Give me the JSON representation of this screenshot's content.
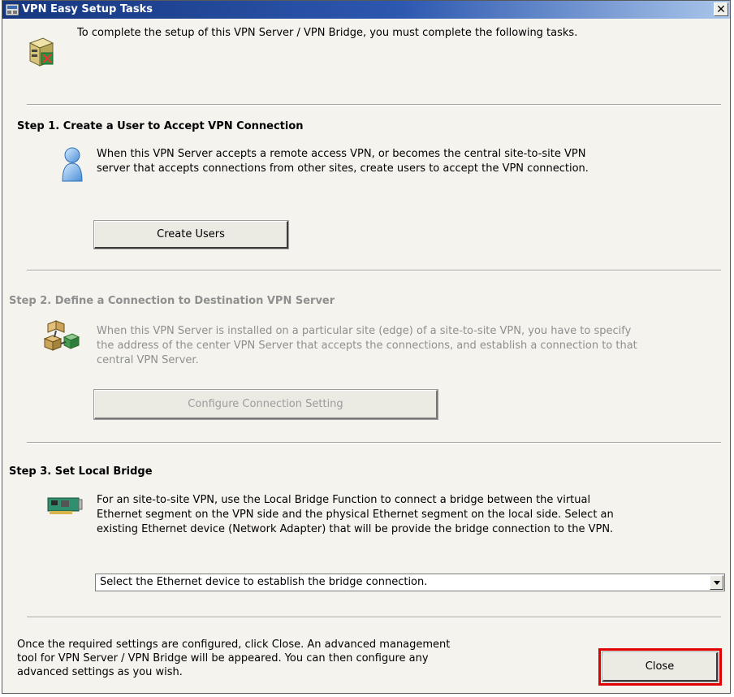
{
  "window": {
    "title": "VPN Easy Setup Tasks",
    "close_glyph": "✕"
  },
  "intro": "To complete the setup of this VPN Server / VPN Bridge, you must complete the following tasks.",
  "step1": {
    "title": "Step 1. Create a User to Accept VPN Connection",
    "desc_line1": "When this VPN Server accepts a remote access VPN, or becomes the central site-to-site VPN",
    "desc_line2": "server that accepts connections from other sites, create users to accept the VPN connection.",
    "button": "Create Users"
  },
  "step2": {
    "title": "Step 2. Define a Connection to Destination VPN Server",
    "desc_line1": "When this VPN Server is installed on a particular site (edge) of a site-to-site VPN, you have to specify",
    "desc_line2": "the address of the center VPN Server that accepts the connections, and establish a connection to that",
    "desc_line3": "central VPN Server.",
    "button": "Configure Connection Setting"
  },
  "step3": {
    "title": "Step 3. Set Local Bridge",
    "desc_line1": "For an site-to-site VPN, use the Local Bridge Function to connect a bridge between the virtual",
    "desc_line2": "Ethernet segment on the VPN side and the physical Ethernet segment on the local side. Select an",
    "desc_line3": "existing Ethernet device (Network Adapter) that will be provide the bridge connection to the VPN.",
    "select_value": "Select the Ethernet device to establish the bridge connection."
  },
  "footer": {
    "line1": "Once the required settings are configured, click Close. An advanced management",
    "line2": "tool for VPN Server / VPN Bridge will be appeared. You can then configure any",
    "line3": "advanced settings as you wish.",
    "close_button": "Close"
  },
  "icons": {
    "app": "vpn-app-icon",
    "server": "server-icon",
    "user": "user-icon",
    "connection": "connection-icon",
    "network_adapter": "network-adapter-icon"
  },
  "colors": {
    "titlebar_start": "#16367f",
    "titlebar_end": "#a9c6ea",
    "highlight": "#e00000",
    "disabled_text": "#8f8f8f"
  }
}
